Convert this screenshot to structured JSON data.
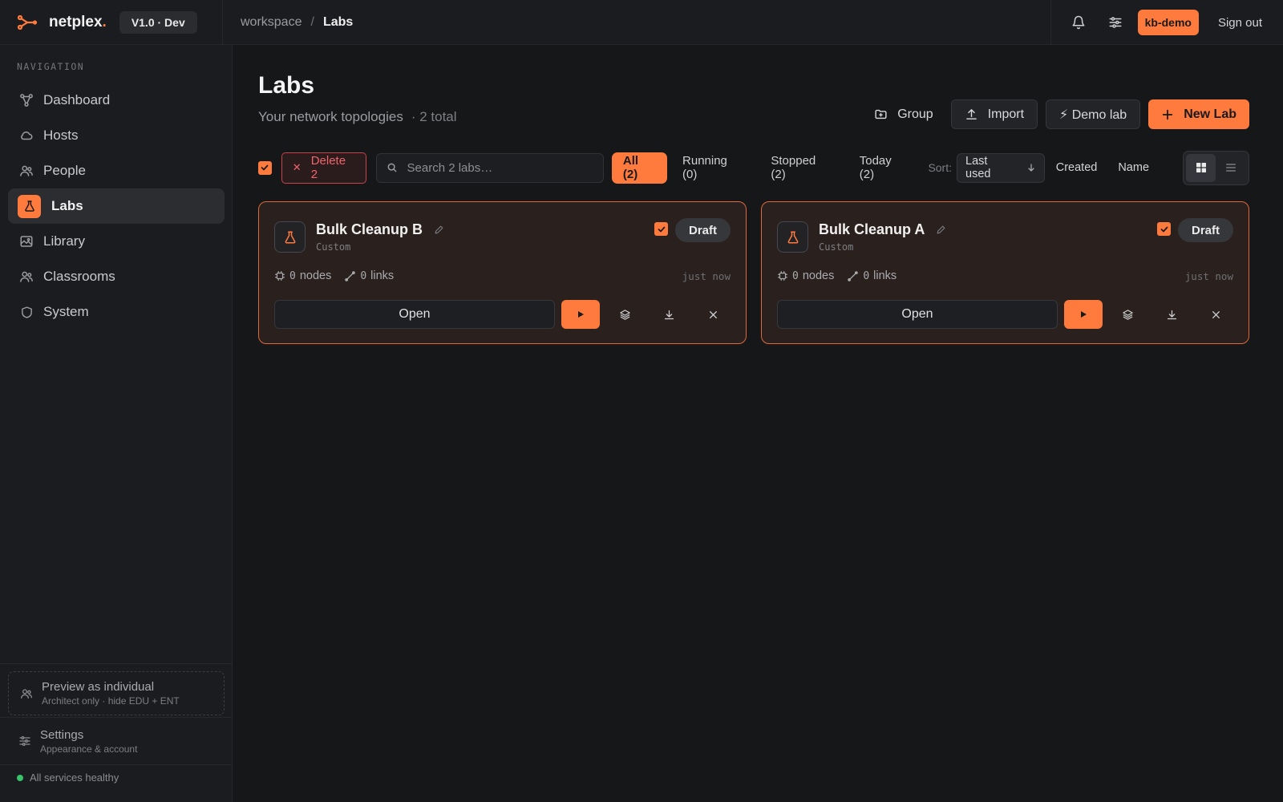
{
  "app": {
    "brand": "netplex",
    "brand_dot": ".",
    "version": "V1.0 · Dev"
  },
  "breadcrumb": {
    "root": "workspace",
    "separator": "/",
    "current": "Labs"
  },
  "topbar": {
    "user_badge": "kb-demo",
    "sign_out": "Sign out"
  },
  "sidebar": {
    "header": "NAVIGATION",
    "items": [
      {
        "label": "Dashboard",
        "icon": "graph-icon",
        "active": false
      },
      {
        "label": "Hosts",
        "icon": "cloud-icon",
        "active": false
      },
      {
        "label": "People",
        "icon": "users-icon",
        "active": false
      },
      {
        "label": "Labs",
        "icon": "flask-icon",
        "active": true
      },
      {
        "label": "Library",
        "icon": "image-icon",
        "active": false
      },
      {
        "label": "Classrooms",
        "icon": "users-icon",
        "active": false
      },
      {
        "label": "System",
        "icon": "shield-icon",
        "active": false
      }
    ],
    "preview": {
      "title": "Preview as individual",
      "subtitle": "Architect only · hide EDU + ENT"
    },
    "settings": {
      "title": "Settings",
      "subtitle": "Appearance & account"
    },
    "status": "All services healthy"
  },
  "page": {
    "title": "Labs",
    "subtitle": "Your network topologies",
    "count": "· 2 total"
  },
  "actions": {
    "group": "Group",
    "import": "Import",
    "demo": "⚡ Demo lab",
    "new": "New Lab"
  },
  "toolbar": {
    "delete": "Delete 2",
    "search_placeholder": "Search 2 labs…",
    "filters": [
      "All (2)",
      "Running (0)",
      "Stopped (2)",
      "Today (2)"
    ],
    "sort_label": "Sort:",
    "sort_selected": "Last used",
    "sort_options": [
      "Created",
      "Name"
    ]
  },
  "labs": [
    {
      "name": "Bulk Cleanup B",
      "type": "Custom",
      "status": "Draft",
      "nodes": "0",
      "nodes_label": "nodes",
      "links": "0",
      "links_label": "links",
      "time": "just now",
      "open": "Open",
      "selected": true
    },
    {
      "name": "Bulk Cleanup A",
      "type": "Custom",
      "status": "Draft",
      "nodes": "0",
      "nodes_label": "nodes",
      "links": "0",
      "links_label": "links",
      "time": "just now",
      "open": "Open",
      "selected": true
    }
  ],
  "colors": {
    "accent": "#ff7a3d",
    "danger": "#f0646a",
    "healthy": "#37c46a",
    "background": "#161719"
  }
}
